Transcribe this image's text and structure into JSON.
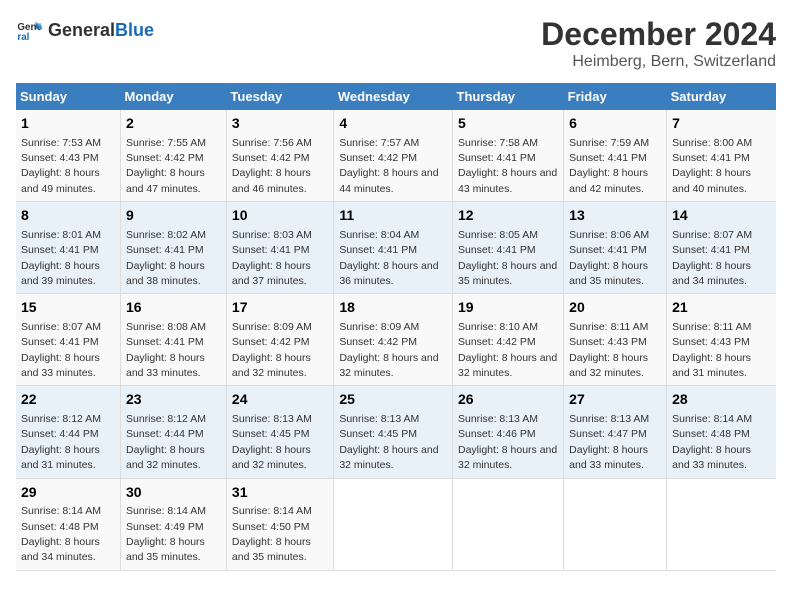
{
  "logo": {
    "text_general": "General",
    "text_blue": "Blue"
  },
  "title": "December 2024",
  "subtitle": "Heimberg, Bern, Switzerland",
  "days_header": [
    "Sunday",
    "Monday",
    "Tuesday",
    "Wednesday",
    "Thursday",
    "Friday",
    "Saturday"
  ],
  "weeks": [
    [
      {
        "day": "1",
        "sunrise": "Sunrise: 7:53 AM",
        "sunset": "Sunset: 4:43 PM",
        "daylight": "Daylight: 8 hours and 49 minutes."
      },
      {
        "day": "2",
        "sunrise": "Sunrise: 7:55 AM",
        "sunset": "Sunset: 4:42 PM",
        "daylight": "Daylight: 8 hours and 47 minutes."
      },
      {
        "day": "3",
        "sunrise": "Sunrise: 7:56 AM",
        "sunset": "Sunset: 4:42 PM",
        "daylight": "Daylight: 8 hours and 46 minutes."
      },
      {
        "day": "4",
        "sunrise": "Sunrise: 7:57 AM",
        "sunset": "Sunset: 4:42 PM",
        "daylight": "Daylight: 8 hours and 44 minutes."
      },
      {
        "day": "5",
        "sunrise": "Sunrise: 7:58 AM",
        "sunset": "Sunset: 4:41 PM",
        "daylight": "Daylight: 8 hours and 43 minutes."
      },
      {
        "day": "6",
        "sunrise": "Sunrise: 7:59 AM",
        "sunset": "Sunset: 4:41 PM",
        "daylight": "Daylight: 8 hours and 42 minutes."
      },
      {
        "day": "7",
        "sunrise": "Sunrise: 8:00 AM",
        "sunset": "Sunset: 4:41 PM",
        "daylight": "Daylight: 8 hours and 40 minutes."
      }
    ],
    [
      {
        "day": "8",
        "sunrise": "Sunrise: 8:01 AM",
        "sunset": "Sunset: 4:41 PM",
        "daylight": "Daylight: 8 hours and 39 minutes."
      },
      {
        "day": "9",
        "sunrise": "Sunrise: 8:02 AM",
        "sunset": "Sunset: 4:41 PM",
        "daylight": "Daylight: 8 hours and 38 minutes."
      },
      {
        "day": "10",
        "sunrise": "Sunrise: 8:03 AM",
        "sunset": "Sunset: 4:41 PM",
        "daylight": "Daylight: 8 hours and 37 minutes."
      },
      {
        "day": "11",
        "sunrise": "Sunrise: 8:04 AM",
        "sunset": "Sunset: 4:41 PM",
        "daylight": "Daylight: 8 hours and 36 minutes."
      },
      {
        "day": "12",
        "sunrise": "Sunrise: 8:05 AM",
        "sunset": "Sunset: 4:41 PM",
        "daylight": "Daylight: 8 hours and 35 minutes."
      },
      {
        "day": "13",
        "sunrise": "Sunrise: 8:06 AM",
        "sunset": "Sunset: 4:41 PM",
        "daylight": "Daylight: 8 hours and 35 minutes."
      },
      {
        "day": "14",
        "sunrise": "Sunrise: 8:07 AM",
        "sunset": "Sunset: 4:41 PM",
        "daylight": "Daylight: 8 hours and 34 minutes."
      }
    ],
    [
      {
        "day": "15",
        "sunrise": "Sunrise: 8:07 AM",
        "sunset": "Sunset: 4:41 PM",
        "daylight": "Daylight: 8 hours and 33 minutes."
      },
      {
        "day": "16",
        "sunrise": "Sunrise: 8:08 AM",
        "sunset": "Sunset: 4:41 PM",
        "daylight": "Daylight: 8 hours and 33 minutes."
      },
      {
        "day": "17",
        "sunrise": "Sunrise: 8:09 AM",
        "sunset": "Sunset: 4:42 PM",
        "daylight": "Daylight: 8 hours and 32 minutes."
      },
      {
        "day": "18",
        "sunrise": "Sunrise: 8:09 AM",
        "sunset": "Sunset: 4:42 PM",
        "daylight": "Daylight: 8 hours and 32 minutes."
      },
      {
        "day": "19",
        "sunrise": "Sunrise: 8:10 AM",
        "sunset": "Sunset: 4:42 PM",
        "daylight": "Daylight: 8 hours and 32 minutes."
      },
      {
        "day": "20",
        "sunrise": "Sunrise: 8:11 AM",
        "sunset": "Sunset: 4:43 PM",
        "daylight": "Daylight: 8 hours and 32 minutes."
      },
      {
        "day": "21",
        "sunrise": "Sunrise: 8:11 AM",
        "sunset": "Sunset: 4:43 PM",
        "daylight": "Daylight: 8 hours and 31 minutes."
      }
    ],
    [
      {
        "day": "22",
        "sunrise": "Sunrise: 8:12 AM",
        "sunset": "Sunset: 4:44 PM",
        "daylight": "Daylight: 8 hours and 31 minutes."
      },
      {
        "day": "23",
        "sunrise": "Sunrise: 8:12 AM",
        "sunset": "Sunset: 4:44 PM",
        "daylight": "Daylight: 8 hours and 32 minutes."
      },
      {
        "day": "24",
        "sunrise": "Sunrise: 8:13 AM",
        "sunset": "Sunset: 4:45 PM",
        "daylight": "Daylight: 8 hours and 32 minutes."
      },
      {
        "day": "25",
        "sunrise": "Sunrise: 8:13 AM",
        "sunset": "Sunset: 4:45 PM",
        "daylight": "Daylight: 8 hours and 32 minutes."
      },
      {
        "day": "26",
        "sunrise": "Sunrise: 8:13 AM",
        "sunset": "Sunset: 4:46 PM",
        "daylight": "Daylight: 8 hours and 32 minutes."
      },
      {
        "day": "27",
        "sunrise": "Sunrise: 8:13 AM",
        "sunset": "Sunset: 4:47 PM",
        "daylight": "Daylight: 8 hours and 33 minutes."
      },
      {
        "day": "28",
        "sunrise": "Sunrise: 8:14 AM",
        "sunset": "Sunset: 4:48 PM",
        "daylight": "Daylight: 8 hours and 33 minutes."
      }
    ],
    [
      {
        "day": "29",
        "sunrise": "Sunrise: 8:14 AM",
        "sunset": "Sunset: 4:48 PM",
        "daylight": "Daylight: 8 hours and 34 minutes."
      },
      {
        "day": "30",
        "sunrise": "Sunrise: 8:14 AM",
        "sunset": "Sunset: 4:49 PM",
        "daylight": "Daylight: 8 hours and 35 minutes."
      },
      {
        "day": "31",
        "sunrise": "Sunrise: 8:14 AM",
        "sunset": "Sunset: 4:50 PM",
        "daylight": "Daylight: 8 hours and 35 minutes."
      },
      null,
      null,
      null,
      null
    ]
  ]
}
